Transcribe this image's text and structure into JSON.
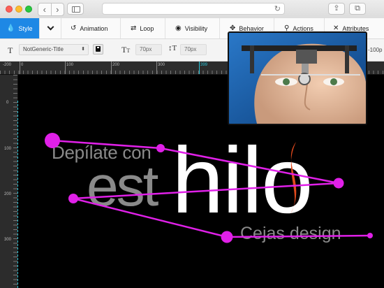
{
  "toolbar_tabs": [
    {
      "label": "Style",
      "icon": "drop-icon",
      "active": true
    },
    {
      "label": "Animation",
      "icon": "history-icon"
    },
    {
      "label": "Loop",
      "icon": "loop-icon"
    },
    {
      "label": "Visibility",
      "icon": "eye-icon"
    },
    {
      "label": "Behavior",
      "icon": "move-icon"
    },
    {
      "label": "Actions",
      "icon": "link-icon"
    },
    {
      "label": "Attributes",
      "icon": "tools-icon"
    }
  ],
  "properties": {
    "style_name": "NotGeneric-Title",
    "font_size": "70px",
    "line_height": "70px",
    "letter_spacing": "-100p"
  },
  "ruler": {
    "h_labels": [
      "0",
      "100",
      "200",
      "300",
      "399"
    ],
    "v_labels": [
      "0",
      "100",
      "200",
      "300"
    ],
    "h_marker": "399",
    "h_neg": "-200"
  },
  "canvas_text": {
    "line1": "Depílate con",
    "est": "est",
    "hilo": "hilo",
    "line3": "Cejas design"
  },
  "colors": {
    "accent": "#1e88e5",
    "path": "#e020e8",
    "guide": "#29c3d6",
    "flame": "#e0491c"
  }
}
